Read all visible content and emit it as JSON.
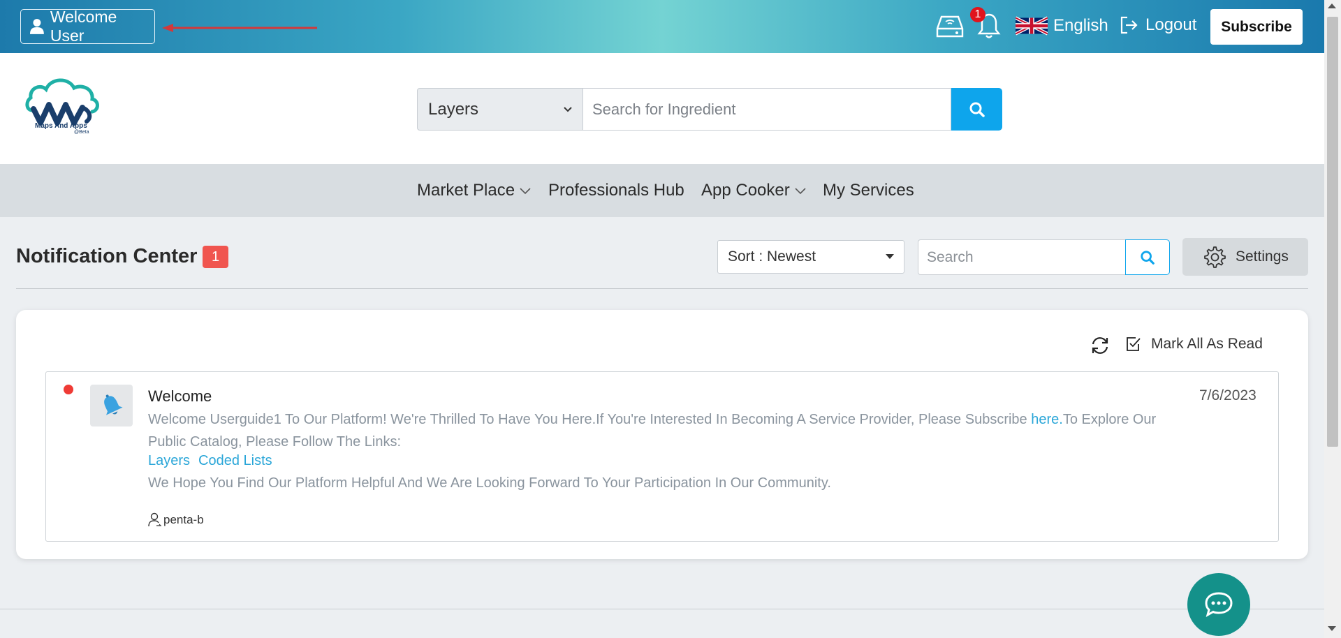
{
  "topbar": {
    "welcome_label": "Welcome User",
    "notification_count": "1",
    "language": "English",
    "logout_label": "Logout",
    "subscribe_label": "Subscribe"
  },
  "header": {
    "logo_text": "Maps And Apps",
    "logo_beta": "@Beta",
    "search_category": "Layers",
    "search_placeholder": "Search for Ingredient"
  },
  "nav": {
    "items": [
      {
        "label": "Market Place"
      },
      {
        "label": "Professionals Hub"
      },
      {
        "label": "App Cooker"
      },
      {
        "label": "My Services"
      }
    ]
  },
  "notification_center": {
    "title": "Notification Center",
    "count": "1",
    "sort_label": "Sort : Newest",
    "search_placeholder": "Search",
    "settings_label": "Settings",
    "mark_all_label": "Mark All As Read"
  },
  "notification": {
    "title": "Welcome",
    "date": "7/6/2023",
    "body_part1": "Welcome Userguide1 To Our Platform! We're Thrilled To Have You Here.If You're Interested In Becoming A Service Provider, Please Subscribe ",
    "body_link": "here.",
    "body_part2": "To Explore Our Public Catalog, Please Follow The Links:",
    "link_layers": "Layers",
    "link_coded_lists": "Coded Lists",
    "body_footer": "We Hope You Find Our Platform Helpful And We Are Looking Forward To Your Participation In Our Community.",
    "author": "penta-b"
  },
  "colors": {
    "accent": "#0ea5ec",
    "unread": "#ef3b35",
    "chat": "#14918a"
  }
}
